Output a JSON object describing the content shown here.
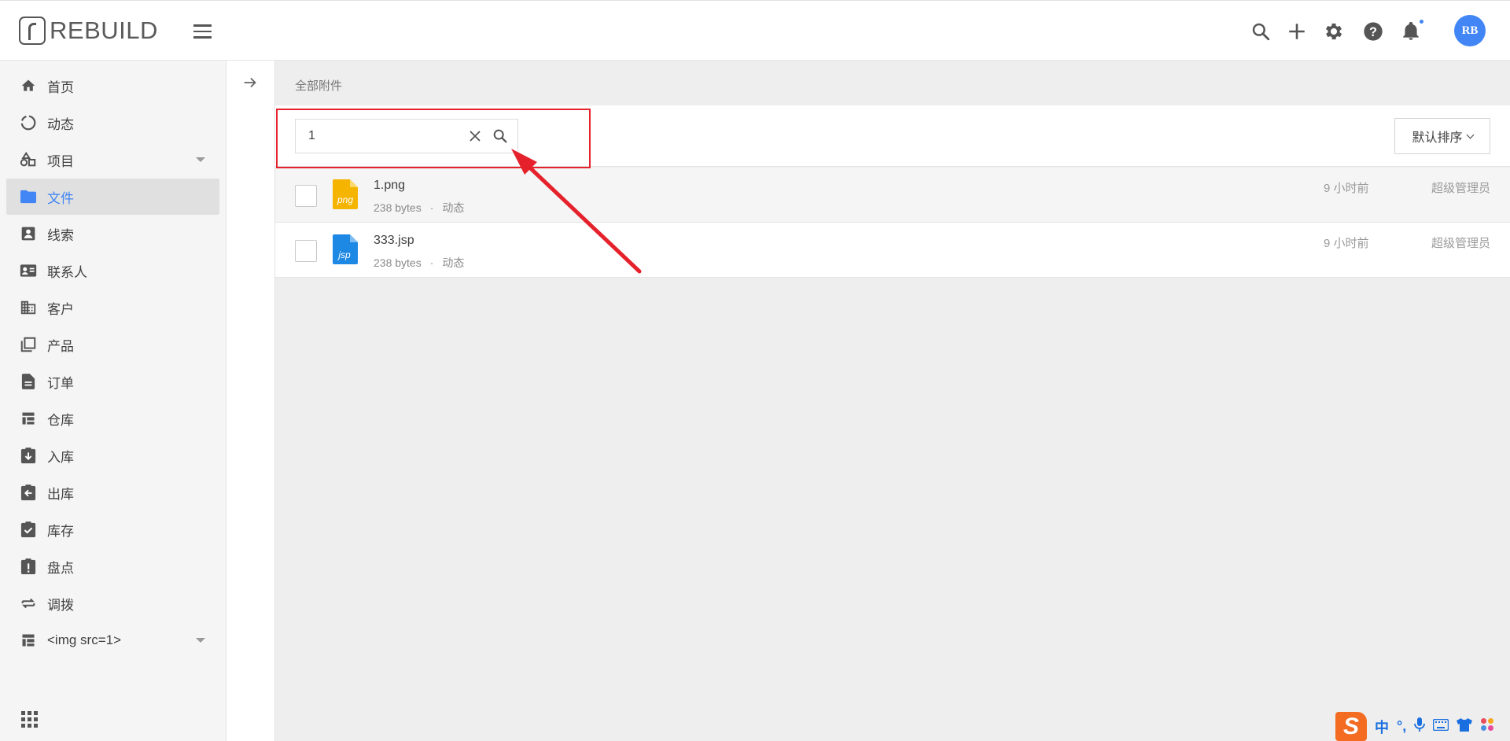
{
  "app": {
    "logo_text": "REBUILD",
    "avatar_initials": "RB"
  },
  "colors": {
    "accent": "#4285f4",
    "png_icon": "#f5b400",
    "jsp_icon": "#1e88e5",
    "annotation": "#e5222b"
  },
  "topbar": {
    "icons": [
      "search-icon",
      "plus-icon",
      "gear-icon",
      "help-icon",
      "bell-icon"
    ]
  },
  "sidebar": {
    "items": [
      {
        "label": "首页",
        "icon": "home-icon"
      },
      {
        "label": "动态",
        "icon": "feed-icon"
      },
      {
        "label": "项目",
        "icon": "project-icon",
        "has_children": true
      },
      {
        "label": "文件",
        "icon": "folder-icon",
        "active": true
      },
      {
        "label": "线索",
        "icon": "lead-icon"
      },
      {
        "label": "联系人",
        "icon": "contact-icon"
      },
      {
        "label": "客户",
        "icon": "building-icon"
      },
      {
        "label": "产品",
        "icon": "product-icon"
      },
      {
        "label": "订单",
        "icon": "document-icon"
      },
      {
        "label": "仓库",
        "icon": "warehouse-icon"
      },
      {
        "label": "入库",
        "icon": "inbound-icon"
      },
      {
        "label": "出库",
        "icon": "outbound-icon"
      },
      {
        "label": "库存",
        "icon": "inventory-icon"
      },
      {
        "label": "盘点",
        "icon": "stocktake-icon"
      },
      {
        "label": "调拨",
        "icon": "transfer-icon"
      },
      {
        "label": "<img src=1>",
        "icon": "table-icon",
        "has_children": true
      }
    ]
  },
  "main": {
    "breadcrumb": "全部附件",
    "search": {
      "value": "1"
    },
    "sort_label": "默认排序",
    "files": [
      {
        "name": "1.png",
        "ext": "png",
        "size": "238 bytes",
        "separator": "·",
        "source": "动态",
        "time": "9 小时前",
        "user": "超级管理员"
      },
      {
        "name": "333.jsp",
        "ext": "jsp",
        "size": "238 bytes",
        "separator": "·",
        "source": "动态",
        "time": "9 小时前",
        "user": "超级管理员"
      }
    ]
  },
  "ime": {
    "logo": "S",
    "lang": "中",
    "punct": "°,"
  }
}
